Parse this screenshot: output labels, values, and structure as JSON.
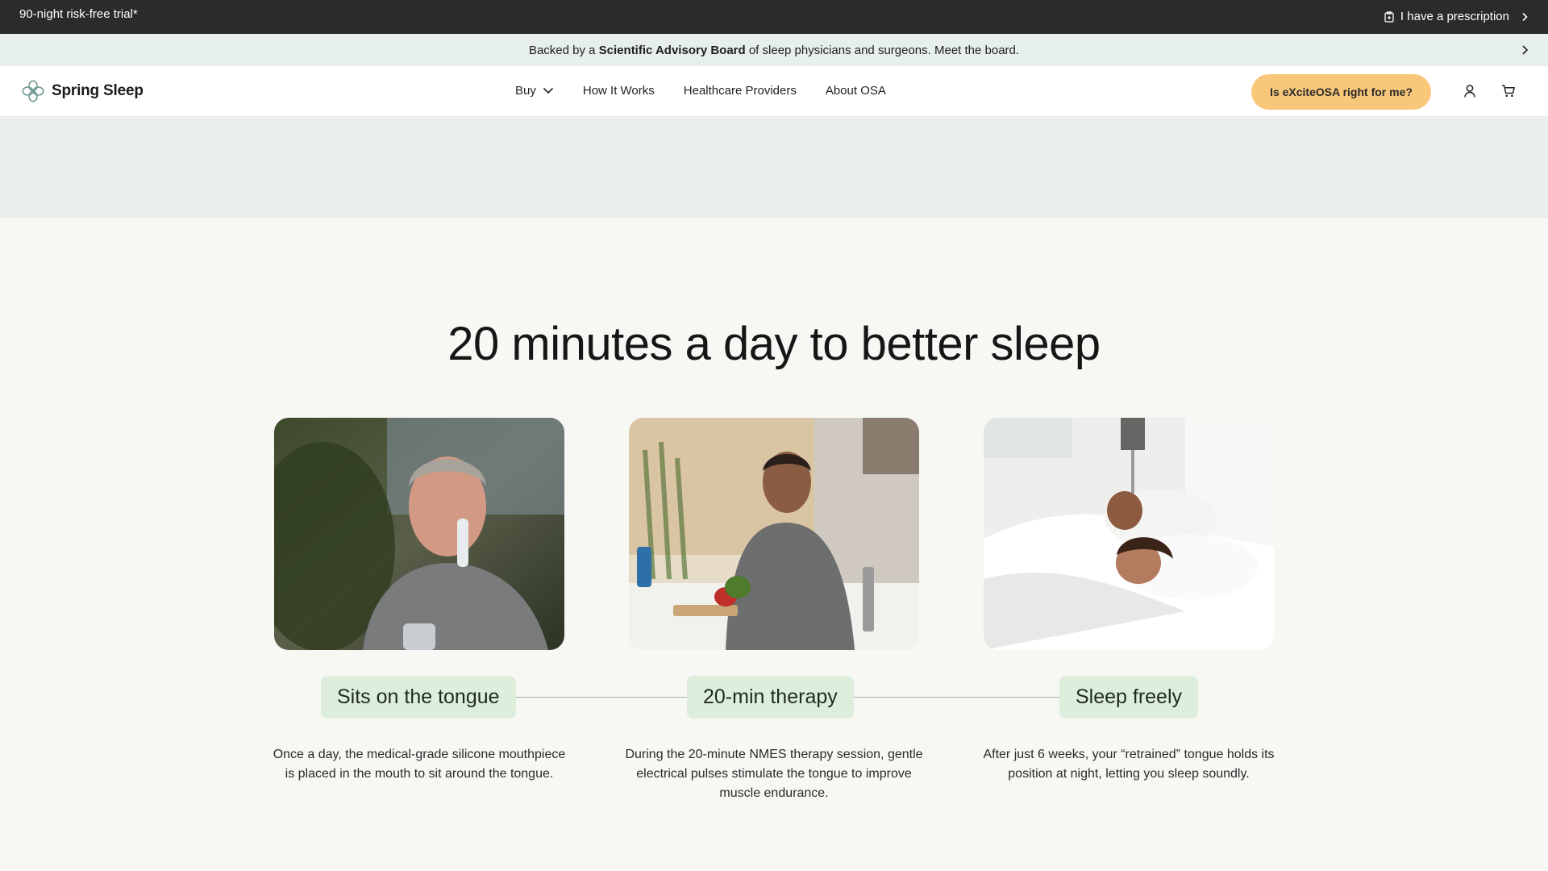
{
  "promo": {
    "trial_text": "90-night risk-free trial*",
    "prescription_label": "I have a prescription"
  },
  "advisory": {
    "prefix": "Backed by a ",
    "bold": "Scientific Advisory Board",
    "suffix": " of sleep physicians and surgeons. Meet the board."
  },
  "nav": {
    "brand": "Spring Sleep",
    "links": [
      "Buy",
      "How It Works",
      "Healthcare Providers",
      "About OSA"
    ],
    "cta_label": "Is eXciteOSA right for me?",
    "icons": [
      "user-icon",
      "cart-icon"
    ]
  },
  "section": {
    "headline": "20 minutes a day to better sleep",
    "steps": [
      {
        "label": "Sits on the tongue",
        "description": "Once a day, the medical-grade silicone mouthpiece is placed in the mouth to sit around the tongue."
      },
      {
        "label": "20-min therapy",
        "description": "During the 20-minute NMES therapy session, gentle electrical pulses stimulate the tongue to improve muscle endurance."
      },
      {
        "label": "Sleep freely",
        "description": "After just 6 weeks, your “retrained” tongue holds its position at night, letting you sleep soundly."
      }
    ]
  },
  "colors": {
    "promo_bg": "#2b2b2b",
    "advisory_bg": "#e6eeee",
    "cta_bg": "#f8c77a",
    "pill_bg": "#ddeedc",
    "page_bg": "#f7f7f4"
  }
}
